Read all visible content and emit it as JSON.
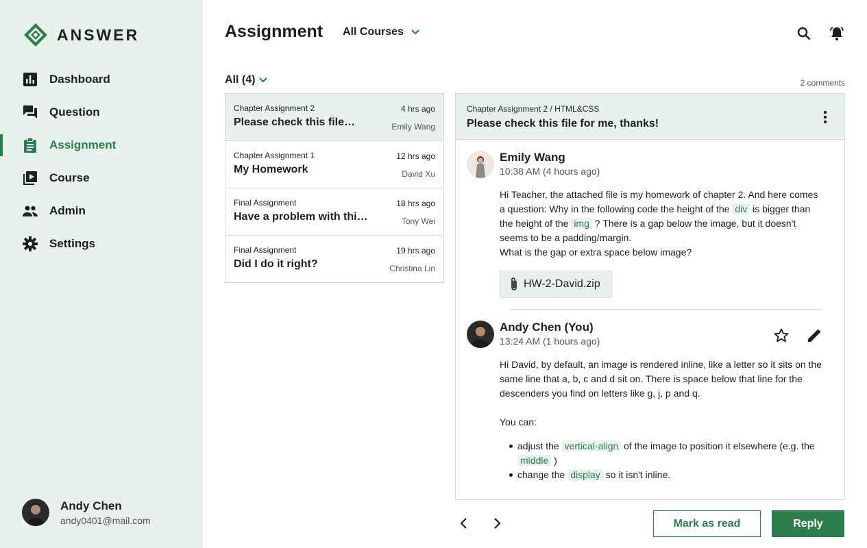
{
  "brand": {
    "name": "ANSWER",
    "color": "#2e7d4f",
    "logo_icon": "answer-logo-icon"
  },
  "sidebar": {
    "items": [
      {
        "label": "Dashboard",
        "icon": "bar-chart-icon",
        "active": false
      },
      {
        "label": "Question",
        "icon": "forum-icon",
        "active": false
      },
      {
        "label": "Assignment",
        "icon": "assignment-icon",
        "active": true
      },
      {
        "label": "Course",
        "icon": "video-library-icon",
        "active": false
      },
      {
        "label": "Admin",
        "icon": "people-icon",
        "active": false
      },
      {
        "label": "Settings",
        "icon": "gear-icon",
        "active": false
      }
    ],
    "user": {
      "name": "Andy Chen",
      "email": "andy0401@mail.com"
    }
  },
  "header": {
    "title": "Assignment",
    "course_filter": "All Courses",
    "icons": [
      "search-icon",
      "bell-icon"
    ]
  },
  "filter": {
    "label": "All (4)"
  },
  "comments_count": "2 comments",
  "list": [
    {
      "chapter": "Chapter Assignment 2",
      "time": "4 hrs ago",
      "title": "Please check this file…",
      "author": "Emily Wang",
      "selected": true
    },
    {
      "chapter": "Chapter Assignment 1",
      "time": "12 hrs ago",
      "title": "My Homework",
      "author": "David Xu",
      "selected": false
    },
    {
      "chapter": "Final Assignment",
      "time": "18 hrs ago",
      "title": "Have a problem with this…",
      "author": "Tony Wei",
      "selected": false
    },
    {
      "chapter": "Final Assignment",
      "time": "19 hrs ago",
      "title": "Did I do it right?",
      "author": "Christina Lin",
      "selected": false
    }
  ],
  "detail": {
    "breadcrumb": "Chapter Assignment 2 / HTML&CSS",
    "title": "Please check this file for me, thanks!",
    "messages": [
      {
        "name": "Emily Wang",
        "time": "10:38 AM (4 hours ago)",
        "body": {
          "p1_a": "Hi Teacher, the attached file is my homework of chapter 2. And here comes a question: Why in the following code the height of the",
          "code1": "div",
          "p1_b": "is bigger than the height of the",
          "code2": "img",
          "p1_c": "? There is a gap below the image, but it doesn't seems to be a padding/margin.",
          "p2": "What is the gap or extra space below image?"
        },
        "attachment": "HW-2-David.zip"
      },
      {
        "name": "Andy Chen (You)",
        "time": "13:24 AM (1 hours ago)",
        "body": {
          "p1": "Hi David, by default, an image is rendered inline, like a letter so it sits on the same line that a, b, c and d sit on. There is space below that line for the descenders you find on letters like g, j, p and q.",
          "p2": "You can:",
          "b1_a": "adjust the",
          "b1_code": "vertical-align",
          "b1_b": "of the image to position it elsewhere (e.g. the",
          "b1_code2": "middle",
          "b1_c": ")",
          "b2_a": "change the",
          "b2_code": "display",
          "b2_b": "so it isn't inline."
        },
        "actions": [
          "star-icon",
          "pencil-icon"
        ]
      }
    ]
  },
  "footer": {
    "mark_read": "Mark as read",
    "reply": "Reply"
  }
}
